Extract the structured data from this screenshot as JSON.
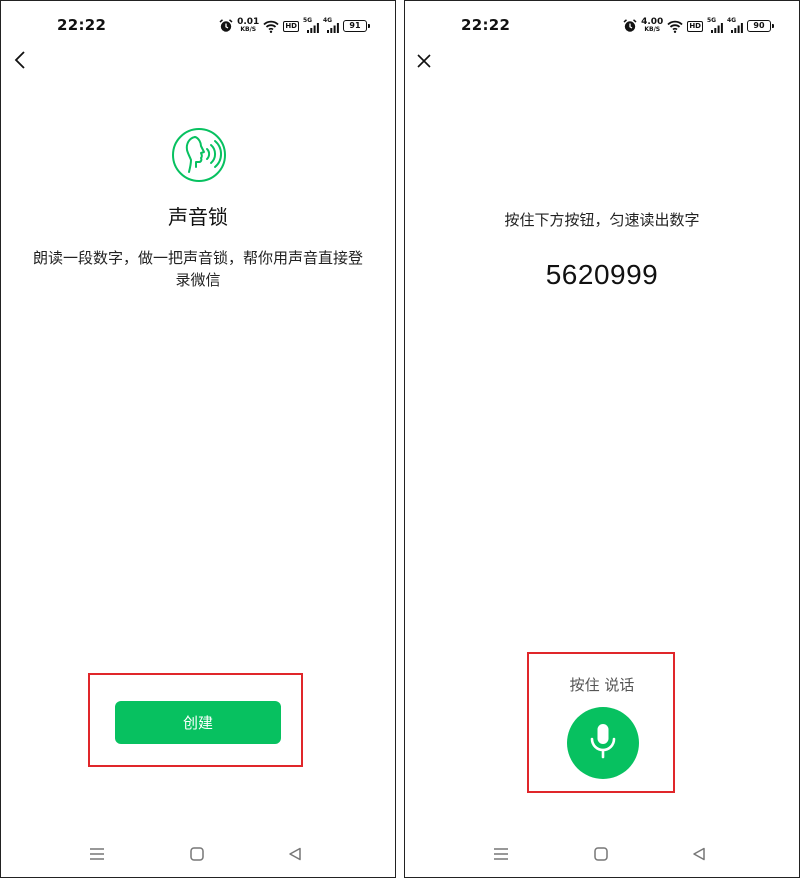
{
  "screens": [
    {
      "status": {
        "time": "22:22",
        "speed_value": "0.01",
        "speed_unit": "KB/S",
        "hd_label": "HD",
        "net1": "5G",
        "net2": "4G",
        "battery": "91"
      },
      "nav_icon": "back-chevron-icon",
      "brand_icon": "voice-face-icon",
      "title": "声音锁",
      "description": "朗读一段数字，做一把声音锁，帮你用声音直接登录微信",
      "create_label": "创建"
    },
    {
      "status": {
        "time": "22:22",
        "speed_value": "4.00",
        "speed_unit": "KB/S",
        "hd_label": "HD",
        "net1": "5G",
        "net2": "4G",
        "battery": "90"
      },
      "nav_icon": "close-icon",
      "instruction": "按住下方按钮，匀速读出数字",
      "number": "5620999",
      "hold_label": "按住 说话",
      "mic_icon": "microphone-icon"
    }
  ],
  "bottom_nav": {
    "icons": [
      "menu-icon",
      "home-square-icon",
      "back-triangle-icon"
    ]
  },
  "colors": {
    "accent": "#07c160",
    "highlight": "#e0262a"
  }
}
